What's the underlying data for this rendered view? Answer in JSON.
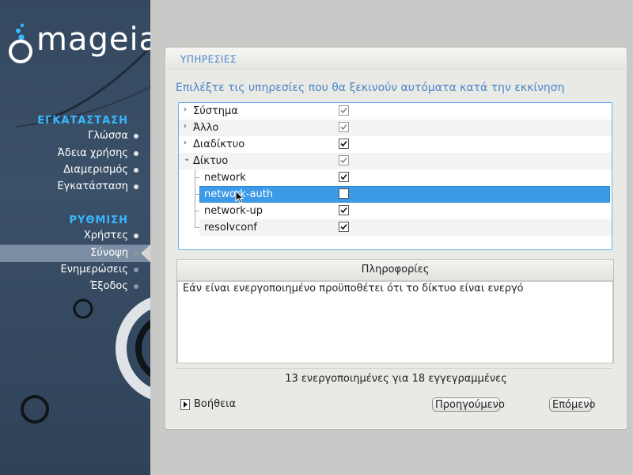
{
  "brand": {
    "logo_text": "mageia"
  },
  "sidebar": {
    "sections": [
      {
        "title": "ΕΓΚΑΤΑΣΤΑΣΗ",
        "steps": [
          "Γλώσσα",
          "Άδεια χρήσης",
          "Διαμερισμός",
          "Εγκατάσταση"
        ]
      },
      {
        "title": "ΡΥΘΜΙΣΗ",
        "steps": [
          "Χρήστες",
          "Σύνοψη",
          "Ενημερώσεις",
          "Έξοδος"
        ]
      }
    ],
    "active_step": "Σύνοψη"
  },
  "panel": {
    "title": "ΥΠΗΡΕΣΙΕΣ",
    "subtitle": "Επιλέξτε τις υπηρεσίες που θα ξεκινούν αυτόματα κατά την εκκίνηση",
    "tree": [
      {
        "label": "Σύστημα",
        "expander": "collapsed",
        "checked": true,
        "grey": true
      },
      {
        "label": "Άλλο",
        "expander": "collapsed",
        "checked": true,
        "grey": true
      },
      {
        "label": "Διαδίκτυο",
        "expander": "collapsed",
        "checked": true,
        "grey": false
      },
      {
        "label": "Δίκτυο",
        "expander": "expanded",
        "checked": true,
        "grey": true
      },
      {
        "label": "network",
        "child": true,
        "checked": true,
        "grey": false
      },
      {
        "label": "network-auth",
        "child": true,
        "checked": false,
        "grey": false,
        "selected": true
      },
      {
        "label": "network-up",
        "child": true,
        "checked": true,
        "grey": false
      },
      {
        "label": "resolvconf",
        "child": true,
        "checked": true,
        "grey": false
      }
    ],
    "info": {
      "header": "Πληροφορίες",
      "text": "Εάν είναι ενεργοποιημένο προϋποθέτει ότι το δίκτυο είναι ενεργό"
    },
    "counts": "13 ενεργοποιημένες για 18 εγγεγραμμένες",
    "help_label": "Βοήθεια",
    "buttons": {
      "previous": "Προηγούμενο",
      "next": "Επόμενο"
    }
  },
  "colors": {
    "accent": "#4a86c8",
    "selection": "#3c9ae8",
    "sidebar_title": "#38b8ff",
    "sidebar_bg": "#34495f"
  }
}
